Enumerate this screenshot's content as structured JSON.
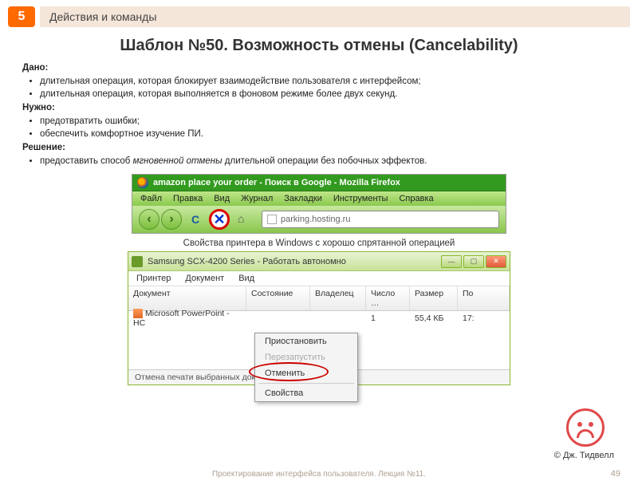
{
  "header": {
    "badge": "5",
    "section": "Действия и команды"
  },
  "title": "Шаблон №50. Возможность отмены (Cancelability)",
  "given": {
    "label": "Дано:",
    "items": [
      "длительная операция, которая блокирует взаимодействие пользователя с интерфейсом;",
      "длительная операция, которая выполняется в фоновом режиме более двух секунд."
    ]
  },
  "need": {
    "label": "Нужно:",
    "items": [
      "предотвратить ошибки;",
      "обеспечить комфортное изучение ПИ."
    ]
  },
  "solution": {
    "label": "Решение:",
    "item_prefix": "предоставить способ ",
    "item_em": "мгновенной отмены",
    "item_suffix": " длительной операции без побочных эффектов."
  },
  "firefox": {
    "title": "amazon place your order - Поиск в Google - Mozilla Firefox",
    "menus": [
      "Файл",
      "Правка",
      "Вид",
      "Журнал",
      "Закладки",
      "Инструменты",
      "Справка"
    ],
    "reload": "C",
    "stop": "✕",
    "url": "parking.hosting.ru"
  },
  "caption2": "Свойства принтера в Windows с хорошо спрятанной операцией",
  "printer": {
    "title": "Samsung SCX-4200 Series - Работать автономно",
    "menus": [
      "Принтер",
      "Документ",
      "Вид"
    ],
    "cols": {
      "doc": "Документ",
      "state": "Состояние",
      "owner": "Владелец",
      "count": "Число …",
      "size": "Размер",
      "pg": "По"
    },
    "row": {
      "name": "Microsoft PowerPoint - НС",
      "count": "1",
      "size": "55,4 КБ",
      "pg": "17:"
    },
    "ctx": {
      "pause": "Приостановить",
      "restart": "Перезапустить",
      "cancel": "Отменить",
      "props": "Свойства"
    },
    "status": "Отмена печати выбранных документов"
  },
  "credit": "© Дж. Тидвелл",
  "footer": "Проектирование интерфейса пользователя. Лекция №11.",
  "page": "49"
}
